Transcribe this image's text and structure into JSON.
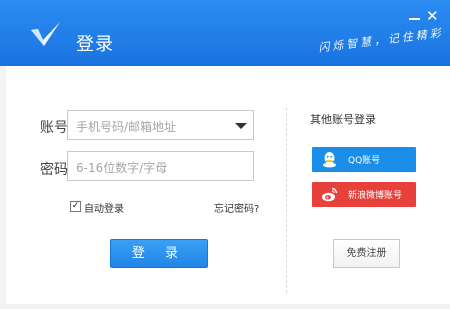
{
  "window": {
    "title": "登录",
    "slogan": "闪烁智慧，记住精彩",
    "close_glyph": "✕"
  },
  "form": {
    "account_label": "账号",
    "account_placeholder": "手机号码/邮箱地址",
    "password_label": "密码",
    "password_placeholder": "6-16位数字/字母",
    "auto_login_label": "自动登录",
    "auto_login_checked": true,
    "forgot_password_label": "忘记密码?",
    "login_button_label": "登 录"
  },
  "social": {
    "title": "其他账号登录",
    "qq_label": "QQ账号",
    "weibo_label": "新浪微博账号"
  },
  "register_label": "免费注册",
  "colors": {
    "brand_blue": "#1a73e0",
    "qq_blue": "#1a8ee8",
    "weibo_red": "#e8413c"
  }
}
